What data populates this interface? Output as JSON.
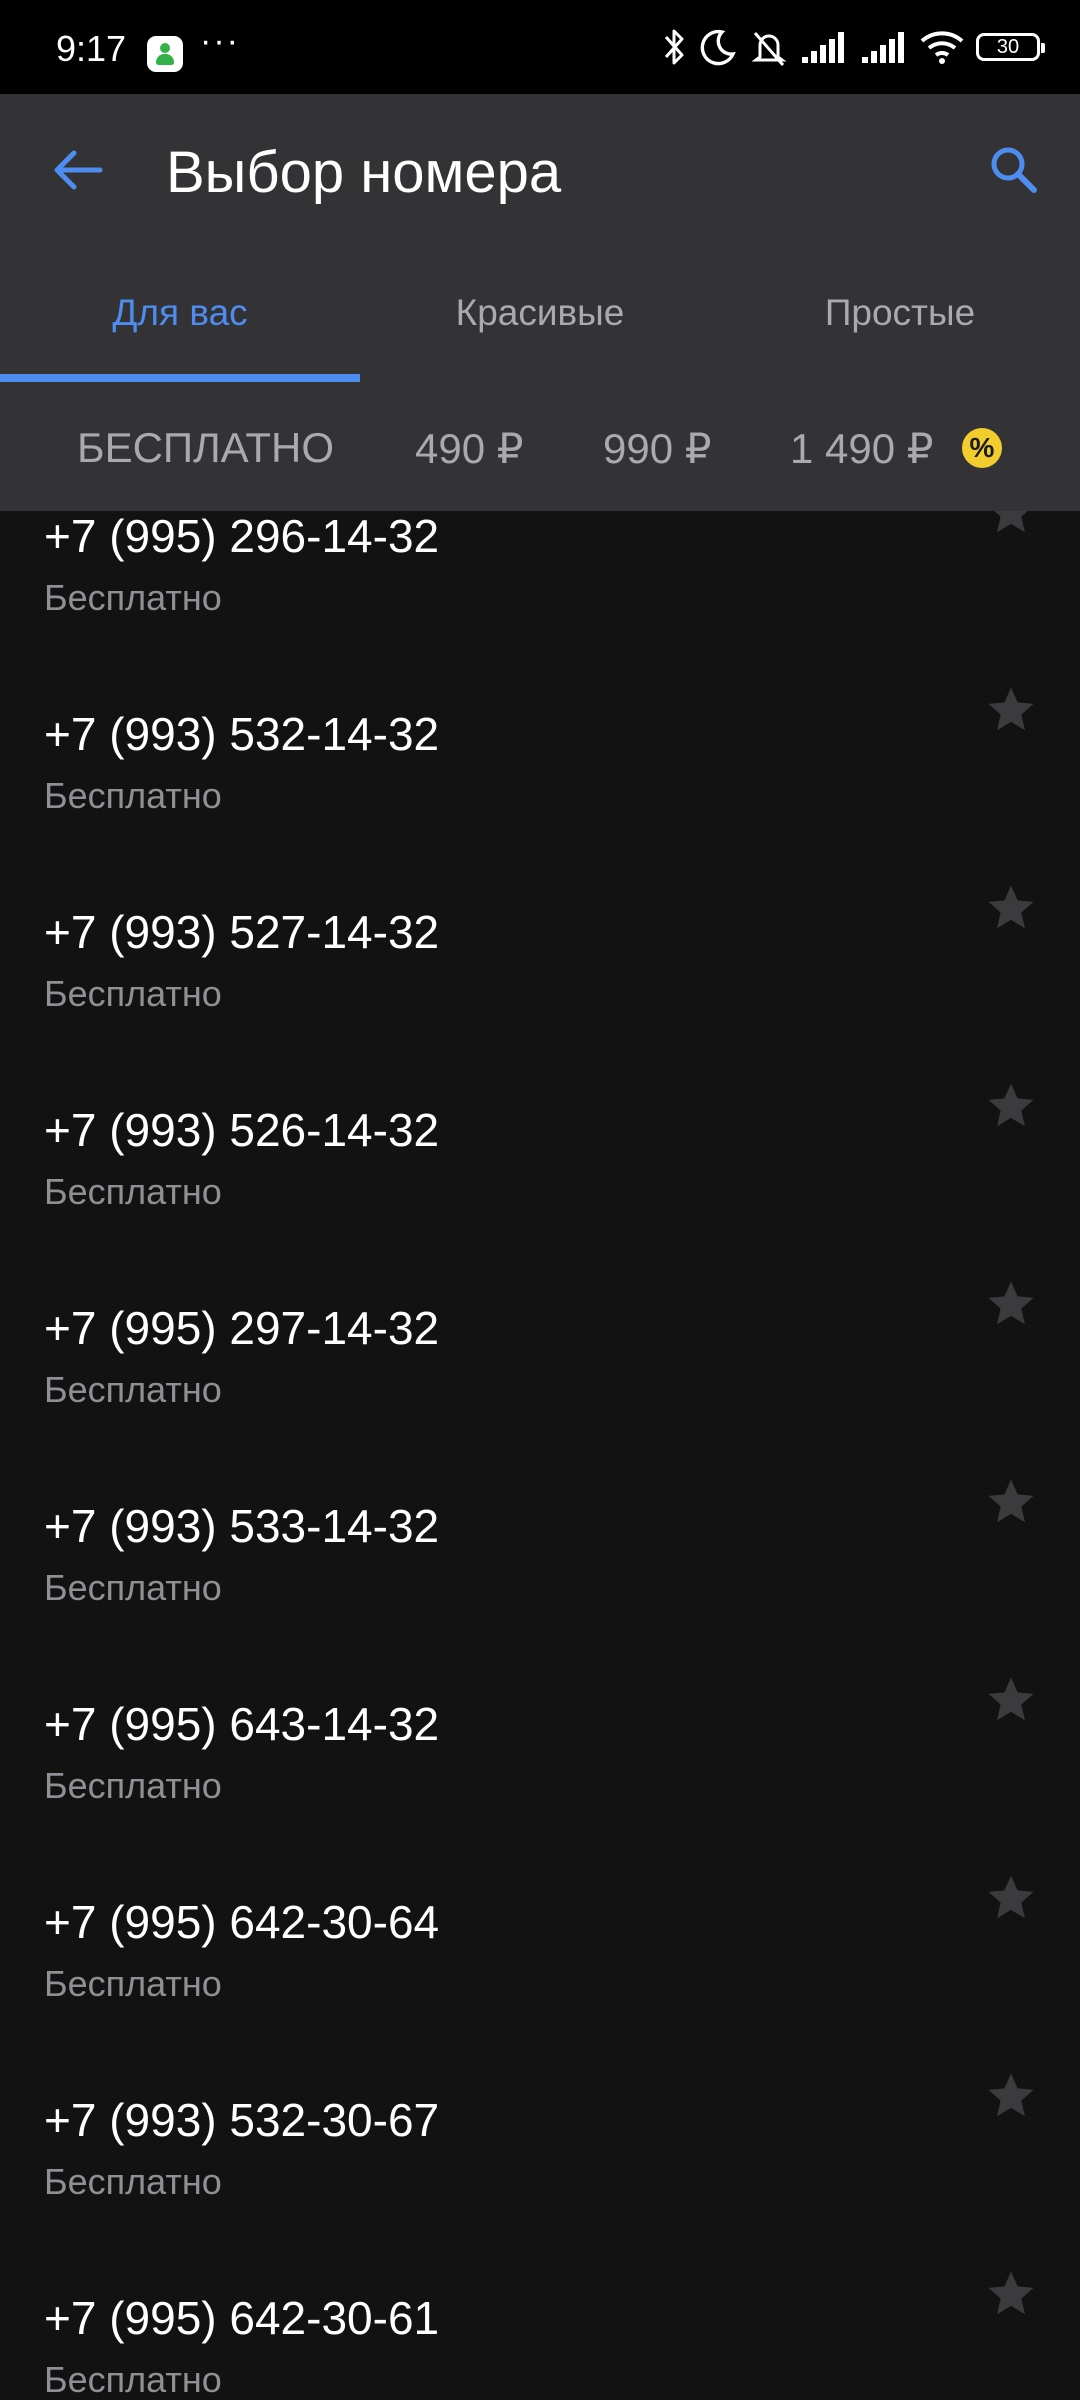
{
  "status_bar": {
    "time": "9:17",
    "more": "···",
    "battery": "30",
    "icons": [
      "app-notification-icon",
      "bluetooth-icon",
      "do-not-disturb-icon",
      "bell-muted-icon",
      "signal-icon",
      "signal-icon",
      "wifi-icon",
      "battery-icon"
    ]
  },
  "header": {
    "title": "Выбор номера",
    "back_icon": "arrow-left-icon",
    "search_icon": "search-icon"
  },
  "tabs": [
    {
      "label": "Для вас",
      "active": true
    },
    {
      "label": "Красивые",
      "active": false
    },
    {
      "label": "Простые",
      "active": false
    }
  ],
  "price_filters": [
    {
      "label": "БЕСПЛАТНО"
    },
    {
      "label": "490 ₽"
    },
    {
      "label": "990 ₽"
    },
    {
      "label": "1 490 ₽",
      "badge": "%"
    }
  ],
  "numbers": [
    {
      "number": "+7 (995) 296-14-32",
      "price": "Бесплатно"
    },
    {
      "number": "+7 (993) 532-14-32",
      "price": "Бесплатно"
    },
    {
      "number": "+7 (993) 527-14-32",
      "price": "Бесплатно"
    },
    {
      "number": "+7 (993) 526-14-32",
      "price": "Бесплатно"
    },
    {
      "number": "+7 (995) 297-14-32",
      "price": "Бесплатно"
    },
    {
      "number": "+7 (993) 533-14-32",
      "price": "Бесплатно"
    },
    {
      "number": "+7 (995) 643-14-32",
      "price": "Бесплатно"
    },
    {
      "number": "+7 (995) 642-30-64",
      "price": "Бесплатно"
    },
    {
      "number": "+7 (993) 532-30-67",
      "price": "Бесплатно"
    },
    {
      "number": "+7 (995) 642-30-61",
      "price": "Бесплатно"
    }
  ],
  "colors": {
    "accent": "#4e8cf0",
    "background": "#121213",
    "header": "#333335",
    "badge": "#f2cd2e",
    "secondary_text": "#8f8f94"
  }
}
